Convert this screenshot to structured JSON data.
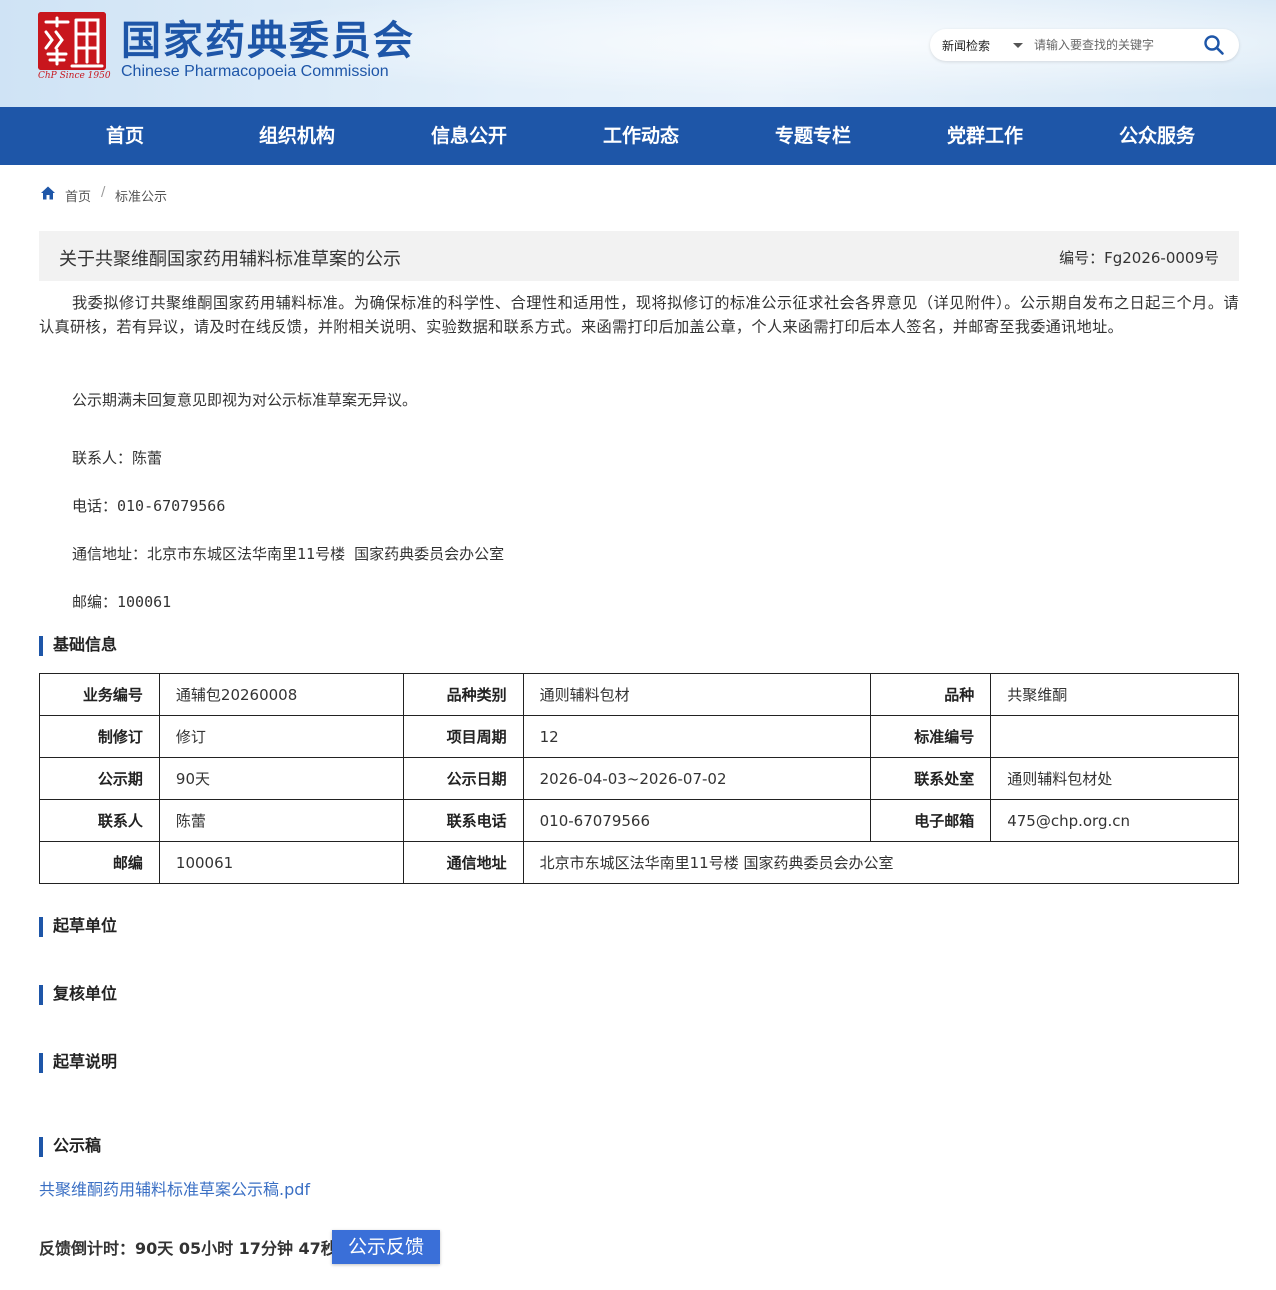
{
  "header": {
    "logo_cn": "国家药典委员会",
    "logo_en": "Chinese Pharmacopoeia Commission",
    "logo_since": "ChP Since 1950",
    "search": {
      "scope": "新闻检索",
      "placeholder": "请输入要查找的关键字",
      "icon": "search-icon"
    }
  },
  "nav": {
    "items": [
      {
        "label": "首页"
      },
      {
        "label": "组织机构"
      },
      {
        "label": "信息公开"
      },
      {
        "label": "工作动态"
      },
      {
        "label": "专题专栏"
      },
      {
        "label": "党群工作"
      },
      {
        "label": "公众服务"
      }
    ]
  },
  "breadcrumb": {
    "icon": "home-icon",
    "items": [
      "首页",
      "标准公示"
    ],
    "separator": "/"
  },
  "article": {
    "title": "关于共聚维酮国家药用辅料标准草案的公示",
    "number": "编号：Fg2026-0009号",
    "paragraph1": "我委拟修订共聚维酮国家药用辅料标准。为确保标准的科学性、合理性和适用性，现将拟修订的标准公示征求社会各界意见（详见附件）。公示期自发布之日起三个月。请认真研核，若有异议，请及时在线反馈，并附相关说明、实验数据和联系方式。来函需打印后加盖公章，个人来函需打印后本人签名，并邮寄至我委通讯地址。",
    "paragraph2": "公示期满未回复意见即视为对公示标准草案无异议。",
    "contact": "联系人：陈蕾",
    "phone": "电话：010-67079566",
    "address": "通信地址：北京市东城区法华南里11号楼  国家药典委员会办公室",
    "postcode": "邮编：100061"
  },
  "sections": {
    "basic": "基础信息",
    "drafter": "起草单位",
    "reviewer": "复核单位",
    "note": "起草说明",
    "draft": "公示稿"
  },
  "table": {
    "rows": [
      [
        "业务编号",
        "通辅包20260008",
        "品种类别",
        "通则辅料包材",
        "品种",
        "共聚维酮"
      ],
      [
        "制修订",
        "修订",
        "项目周期",
        "12",
        "标准编号",
        ""
      ],
      [
        "公示期",
        "90天",
        "公示日期",
        "2026-04-03~2026-07-02",
        "联系处室",
        "通则辅料包材处"
      ],
      [
        "联系人",
        "陈蕾",
        "联系电话",
        "010-67079566",
        "电子邮箱",
        "475@chp.org.cn"
      ],
      [
        "邮编",
        "100061",
        "通信地址",
        "北京市东城区法华南里11号楼 国家药典委员会办公室"
      ]
    ]
  },
  "attachment": {
    "file": "共聚维酮药用辅料标准草案公示稿.pdf"
  },
  "feedback": {
    "countdown": "反馈倒计时：90天 05小时 17分钟 47秒",
    "button": "公示反馈"
  },
  "colors": {
    "brand_blue": "#1e56a8",
    "seal_red": "#c8161d",
    "link_blue": "#3a6fc4",
    "button_blue": "#3a6fd8"
  }
}
